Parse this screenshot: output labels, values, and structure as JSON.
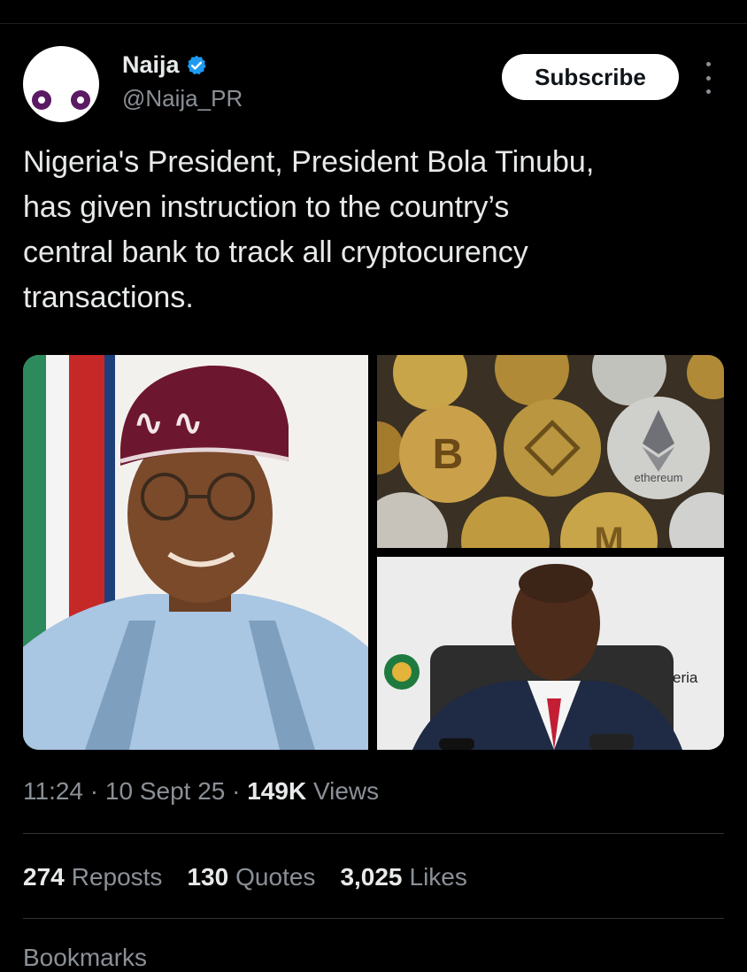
{
  "author": {
    "name": "Naija",
    "handle": "@Naija_PR"
  },
  "actions": {
    "subscribe_label": "Subscribe"
  },
  "tweet": {
    "lines": [
      "Nigeria's President, President Bola Tinubu,",
      "has given instruction to the country’s",
      "central bank to track all cryptocurency",
      "transactions."
    ]
  },
  "media": {
    "coin_label": "ethereum",
    "backdrop_text": "eria"
  },
  "meta": {
    "time": "11:24",
    "date": "10 Sept 25",
    "views_count": "149K",
    "views_label": "Views"
  },
  "stats": {
    "reposts_count": "274",
    "reposts_label": "Reposts",
    "quotes_count": "130",
    "quotes_label": "Quotes",
    "likes_count": "3,025",
    "likes_label": "Likes",
    "bookmarks_partial": "Bookmarks"
  },
  "colors": {
    "background": "#000000",
    "verified": "#1d9bf0",
    "muted_text": "#8b9097"
  }
}
